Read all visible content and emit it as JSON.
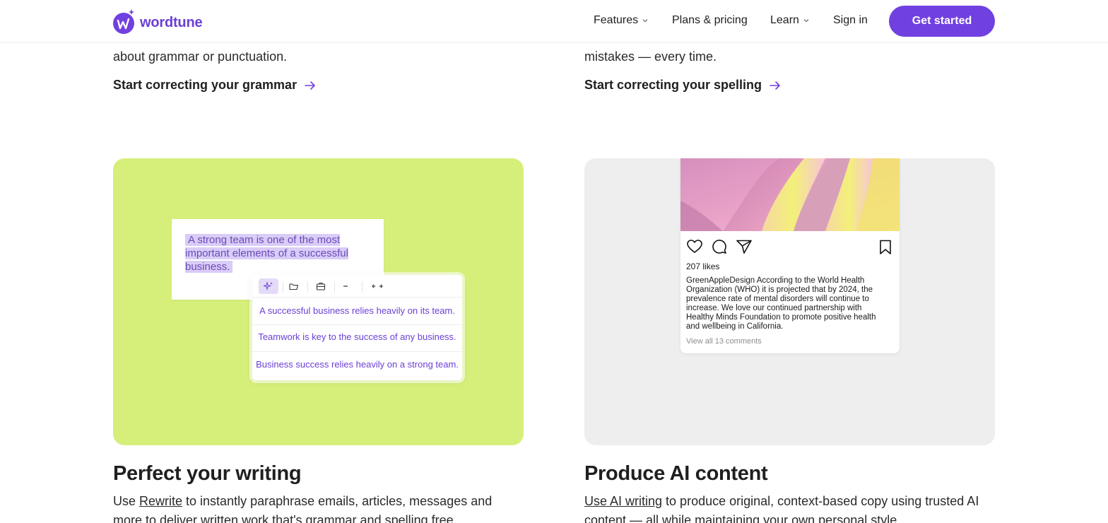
{
  "brand": {
    "name": "wordtune",
    "accent": "#7140e0",
    "card_green": "#d6ef7b",
    "card_gray": "#eeeeee"
  },
  "nav": {
    "features": "Features",
    "plans": "Plans & pricing",
    "learn": "Learn",
    "signin": "Sign in",
    "cta": "Get started"
  },
  "top": {
    "left_text": "about grammar or punctuation.",
    "left_link": "Start correcting your grammar",
    "right_text": "mistakes — every time.",
    "right_link": "Start correcting your spelling"
  },
  "rewrite_demo": {
    "original": "A strong team is one of the most important elements of a successful business.",
    "toolbar_icons": [
      "sparkle-icon",
      "casual-icon",
      "formal-icon",
      "shorten-icon",
      "expand-icon"
    ],
    "suggestions": [
      "A successful business relies heavily on its team.",
      "Teamwork is key to the success of any business.",
      "Business success relies heavily on a strong team."
    ]
  },
  "post_demo": {
    "likes": "207 likes",
    "username": "GreenAppleDesign",
    "caption": "According to the World Health Organization (WHO) it is projected that by 2024, the prevalence rate of mental disorders will continue to increase. We love our continued partnership with Healthy Minds Foundation to promote positive health and wellbeing in California.",
    "comments": "View all 13 comments"
  },
  "sections": {
    "writing": {
      "title": "Perfect your writing",
      "link": "Rewrite",
      "text": " to instantly paraphrase emails, articles, messages and more to deliver written work that's grammar and spelling free.",
      "prefix": "Use "
    },
    "ai": {
      "title": "Produce AI content",
      "link": "Use AI writing",
      "text": " to produce original, context-based copy using trusted AI content — all while maintaining your own personal style."
    }
  }
}
